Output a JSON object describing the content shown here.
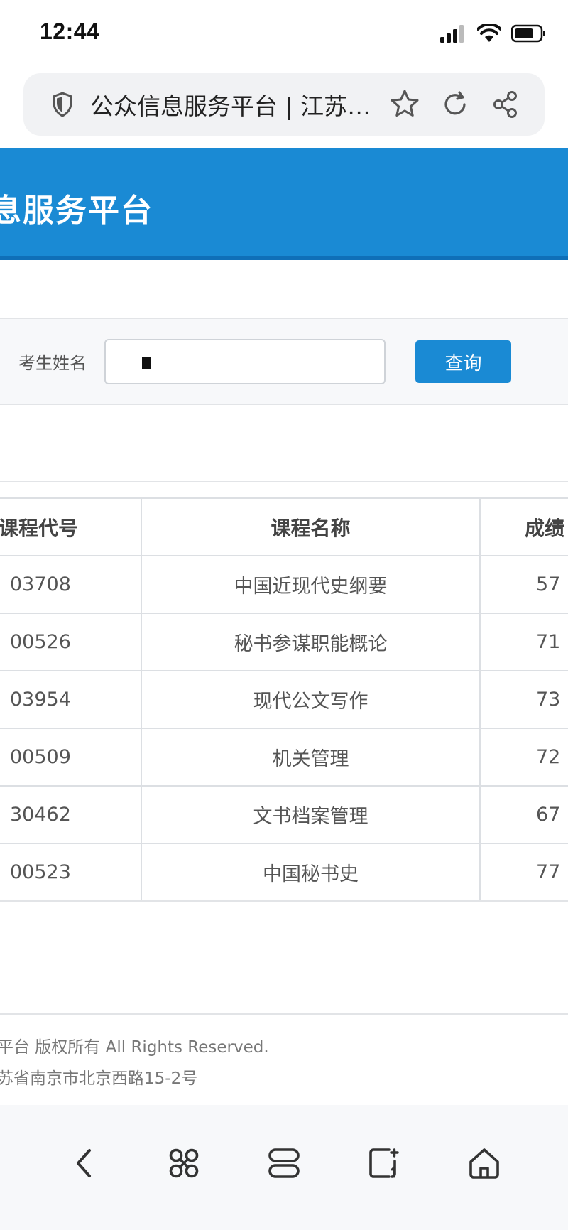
{
  "status_bar": {
    "time": "12:44"
  },
  "browser": {
    "tab_title": "公众信息服务平台 | 江苏…"
  },
  "header": {
    "title": "息服务平台"
  },
  "search": {
    "label": "考生姓名",
    "value": "",
    "button_label": "查询"
  },
  "table": {
    "columns": [
      "课程代号",
      "课程名称",
      "成绩"
    ],
    "rows": [
      {
        "code": "03708",
        "name": "中国近现代史纲要",
        "score": "57"
      },
      {
        "code": "00526",
        "name": "秘书参谋职能概论",
        "score": "71"
      },
      {
        "code": "03954",
        "name": "现代公文写作",
        "score": "73"
      },
      {
        "code": "00509",
        "name": "机关管理",
        "score": "72"
      },
      {
        "code": "30462",
        "name": "文书档案管理",
        "score": "67"
      },
      {
        "code": "00523",
        "name": "中国秘书史",
        "score": "77"
      }
    ]
  },
  "footer": {
    "copyright": "平台 版权所有 All Rights Reserved.",
    "address": "苏省南京市北京西路15-2号"
  },
  "colors": {
    "header_blue": "#1a8ad4",
    "button_blue": "#1a8ad4"
  },
  "icons": {
    "status": [
      "signal-icon",
      "wifi-icon",
      "battery-icon"
    ],
    "address_bar": [
      "shield-icon",
      "star-icon",
      "reload-icon",
      "share-icon"
    ],
    "bottom_nav": [
      "back-icon",
      "command-icon",
      "tabs-icon",
      "tab-add-icon",
      "home-icon"
    ]
  }
}
